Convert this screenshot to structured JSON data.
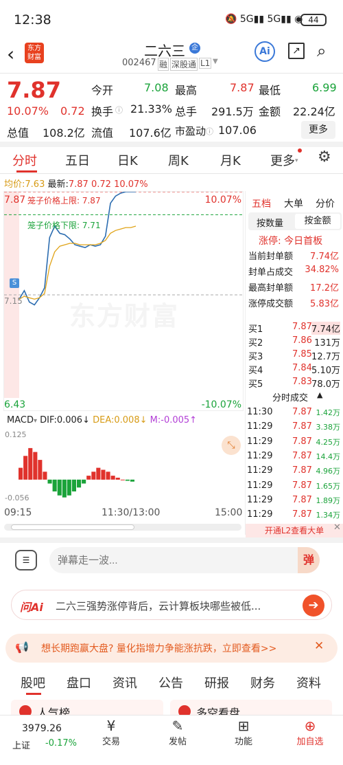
{
  "status": {
    "time": "12:38",
    "battery": "44"
  },
  "header": {
    "title": "二六三",
    "badge": "企",
    "code": "002467",
    "tags": [
      "融",
      "深股通",
      "L1"
    ],
    "logo": "东方\n财富",
    "ai": "Ai"
  },
  "quote": {
    "price": "7.87",
    "pct": "10.07%",
    "chg": "0.72",
    "rows": [
      [
        {
          "k": "今开",
          "v": "7.08",
          "c": "green"
        },
        {
          "k": "最高",
          "v": "7.87",
          "c": "red"
        },
        {
          "k": "最低",
          "v": "6.99",
          "c": "green"
        }
      ],
      [
        {
          "k": "换手",
          "v": "21.33%",
          "c": "dark"
        },
        {
          "k": "总手",
          "v": "291.5万",
          "c": "dark"
        },
        {
          "k": "金额",
          "v": "22.24亿",
          "c": "dark"
        }
      ],
      [
        {
          "k": "总值",
          "v": "108.2亿",
          "c": "dark"
        },
        {
          "k": "流值",
          "v": "107.6亿",
          "c": "dark"
        },
        {
          "k": "市盈动",
          "v": "107.06",
          "c": "dark"
        }
      ]
    ],
    "more": "更多"
  },
  "period_tabs": [
    "分时",
    "五日",
    "日K",
    "周K",
    "月K",
    "更多"
  ],
  "info_line": {
    "avg_label": "均价:",
    "avg": "7.63",
    "latest_label": "最新:",
    "latest": "7.87",
    "chg": "0.72",
    "pct": "10.07%"
  },
  "chart_labels": {
    "top_left": "7.87",
    "top_right": "10.07%",
    "bottom_left": "6.43",
    "bottom_right": "-10.07%",
    "mid": "7.15",
    "upper_limit": "笼子价格上限: 7.87",
    "lower_limit": "笼子价格下限: 7.71",
    "watermark": "东方财富",
    "s_marker": "S"
  },
  "chart_data": {
    "type": "line",
    "ylim": [
      6.43,
      7.87
    ],
    "series": [
      {
        "values": [
          7.12,
          7.18,
          7.1,
          7.08,
          7.13,
          7.2,
          7.55,
          7.63,
          7.58,
          7.57,
          7.54,
          7.5,
          7.49,
          7.48,
          7.5,
          7.49,
          7.5,
          7.56,
          7.79,
          7.84,
          7.86,
          7.87,
          7.87,
          7.87
        ]
      },
      {
        "values": [
          7.12,
          7.14,
          7.13,
          7.12,
          7.13,
          7.16,
          7.35,
          7.45,
          7.49,
          7.5,
          7.51,
          7.51,
          7.5,
          7.5,
          7.5,
          7.5,
          7.51,
          7.53,
          7.58,
          7.6,
          7.61,
          7.62,
          7.62,
          7.63
        ]
      }
    ]
  },
  "macd": {
    "label": "MACD",
    "dif": "DIF:0.006",
    "dea": "DEA:0.008",
    "m": "M:-0.005",
    "top": "0.125",
    "bottom": "-0.056",
    "chart_data": {
      "type": "bar",
      "ylim": [
        -0.056,
        0.125
      ],
      "series": [
        {
          "values": [
            0.03,
            0.06,
            0.08,
            0.07,
            0.05,
            0.02,
            -0.01,
            -0.03,
            -0.04,
            -0.045,
            -0.04,
            -0.03,
            -0.02,
            -0.01,
            0.01,
            0.02,
            0.03,
            0.025,
            0.02,
            0.01,
            0.005,
            0.0,
            -0.003,
            -0.005
          ]
        }
      ]
    }
  },
  "time_axis": {
    "start": "09:15",
    "mid": "11:30/13:00",
    "end": "15:00"
  },
  "side": {
    "tabs": [
      "五档",
      "大单",
      "分价"
    ],
    "sub_tabs": [
      "按数量",
      "按金额"
    ],
    "limit_title": "涨停: 今日首板",
    "stats": [
      {
        "k": "当前封单额",
        "v": "7.74亿"
      },
      {
        "k": "封单占成交",
        "v": "34.82%"
      },
      {
        "k": "最高封单额",
        "v": "17.2亿"
      },
      {
        "k": "涨停成交额",
        "v": "5.83亿"
      }
    ],
    "bids": [
      {
        "k": "买1",
        "p": "7.87",
        "v": "7.74亿"
      },
      {
        "k": "买2",
        "p": "7.86",
        "v": "131万"
      },
      {
        "k": "买3",
        "p": "7.85",
        "v": "12.7万"
      },
      {
        "k": "买4",
        "p": "7.84",
        "v": "5.10万"
      },
      {
        "k": "买5",
        "p": "7.83",
        "v": "78.0万"
      }
    ],
    "trade_title": "分时成交",
    "trades": [
      {
        "t": "11:30",
        "p": "7.87",
        "v": "1.42万"
      },
      {
        "t": "11:29",
        "p": "7.87",
        "v": "3.38万"
      },
      {
        "t": "11:29",
        "p": "7.87",
        "v": "4.25万"
      },
      {
        "t": "11:29",
        "p": "7.87",
        "v": "14.4万"
      },
      {
        "t": "11:29",
        "p": "7.87",
        "v": "4.96万"
      },
      {
        "t": "11:29",
        "p": "7.87",
        "v": "1.65万"
      },
      {
        "t": "11:29",
        "p": "7.87",
        "v": "1.89万"
      },
      {
        "t": "11:29",
        "p": "7.87",
        "v": "1.34万"
      }
    ],
    "l2": "开通L2查看大单"
  },
  "comment": {
    "placeholder": "弹幕走一波...",
    "danmu": "弹"
  },
  "ai_bar": {
    "logo": "问Ai",
    "text": "二六三强势涨停背后，云计算板块哪些被低..."
  },
  "ad": {
    "text": "想长期跑赢大盘? 量化指增力争能涨抗跌，立即查看>>"
  },
  "bottom_tabs": [
    "股吧",
    "盘口",
    "资讯",
    "公告",
    "研报",
    "财务",
    "资料"
  ],
  "cards": [
    "人气榜",
    "多空看盘"
  ],
  "nav": {
    "index_val": "3979.26",
    "index_name": "上证",
    "index_pct": "-0.17%",
    "items": [
      "交易",
      "发帖",
      "功能",
      "加自选"
    ]
  }
}
